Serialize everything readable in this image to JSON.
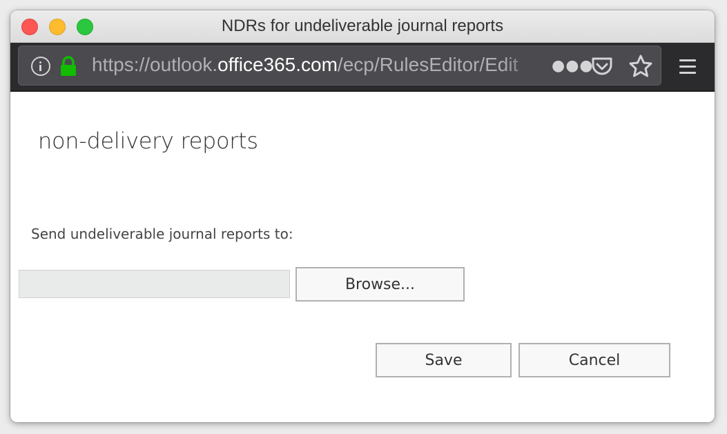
{
  "window": {
    "title": "NDRs for undeliverable journal reports"
  },
  "browser": {
    "url_prefix": "https://outlook.",
    "url_domain": "office365.com",
    "url_path": "/ecp/RulesEditor/Edit",
    "icons": [
      "info-icon",
      "lock-icon",
      "more-icon",
      "pocket-icon",
      "star-icon",
      "menu-icon"
    ],
    "lock_color": "#12bc00"
  },
  "page": {
    "title": "non-delivery reports",
    "field_label": "Send undeliverable journal reports to:",
    "recipient_value": "",
    "browse_label": "Browse...",
    "save_label": "Save",
    "cancel_label": "Cancel"
  }
}
